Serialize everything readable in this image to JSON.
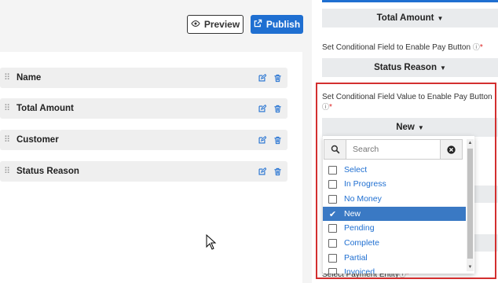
{
  "toolbar": {
    "preview_label": "Preview",
    "publish_label": "Publish",
    "accent": "#1f6fd1"
  },
  "fields": [
    {
      "label": "Name"
    },
    {
      "label": "Total Amount"
    },
    {
      "label": "Customer"
    },
    {
      "label": "Status Reason"
    }
  ],
  "right": {
    "top_dropdown": "Total Amount",
    "cond_field_label": "Set Conditional Field to Enable Pay Button",
    "cond_field_value": "Status Reason",
    "cond_value_label": "Set Conditional Field Value to Enable Pay Button",
    "cond_value_selected": "New",
    "required_mark": "*",
    "payment_entity_label": "Select Payment Entity"
  },
  "menu": {
    "search_placeholder": "Search",
    "options": [
      "Select",
      "In Progress",
      "No Money",
      "New",
      "Pending",
      "Complete",
      "Partial",
      "Invoiced"
    ],
    "selected": "New",
    "selected_color": "#3a79c4"
  },
  "icons": {
    "preview": "eye-icon",
    "publish": "external-link-icon",
    "edit": "edit-icon",
    "delete": "trash-icon",
    "search": "search-icon",
    "clear": "close-circle-icon",
    "hint": "help-circle-icon"
  }
}
